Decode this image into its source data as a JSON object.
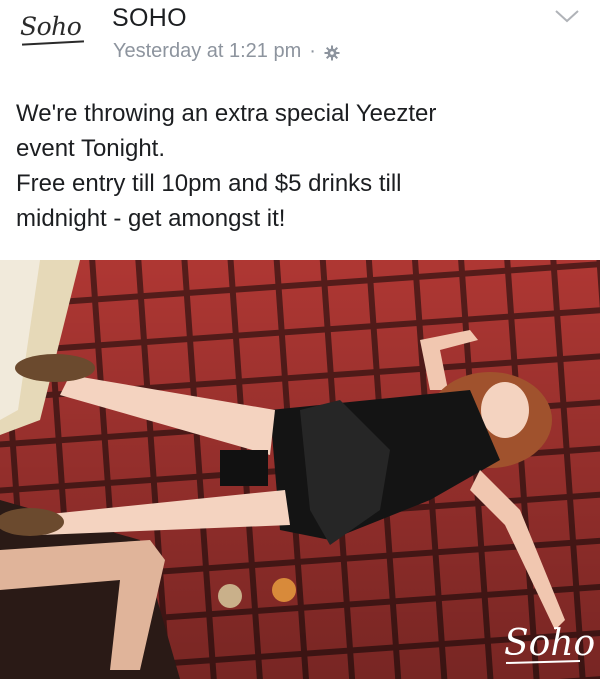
{
  "post": {
    "logo_text": "Soho",
    "page_name": "SOHO",
    "timestamp": "Yesterday at 1:21 pm",
    "separator": "·",
    "privacy_icon": "gear-icon",
    "menu_icon": "chevron-down-icon",
    "text_lines": [
      "We're throwing an extra special Yeezter",
      "event Tonight.",
      "Free entry till 10pm and $5 drinks till",
      "midnight - get amongst it!"
    ],
    "photo_watermark": "Soho"
  },
  "colors": {
    "tile": "#b83a36",
    "grout": "#5a1e1c",
    "text": "#1c1e21",
    "meta": "#8d949e"
  }
}
